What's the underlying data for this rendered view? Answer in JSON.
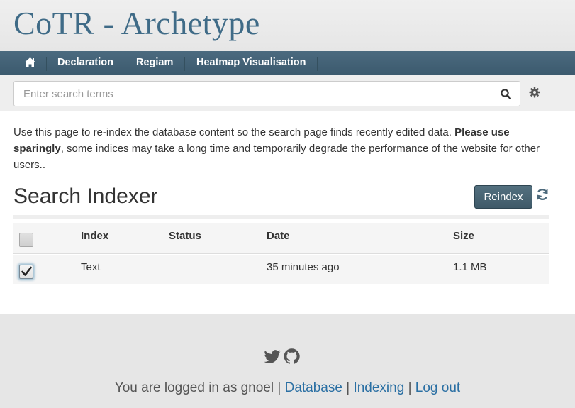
{
  "header": {
    "title": "CoTR - Archetype"
  },
  "nav": {
    "home_icon": "home-icon",
    "items": [
      {
        "label": "Declaration"
      },
      {
        "label": "Regiam"
      },
      {
        "label": "Heatmap Visualisation"
      }
    ]
  },
  "search": {
    "placeholder": "Enter search terms",
    "value": "",
    "button_icon": "search-icon",
    "settings_icon": "gear-icon"
  },
  "intro": {
    "text_before": "Use this page to re-index the database content so the search page finds recently edited data. ",
    "text_bold": "Please use sparingly",
    "text_after": ", some indices may take a long time and temporarily degrade the performance of the website for other users.."
  },
  "indexer": {
    "title": "Search Indexer",
    "reindex_label": "Reindex",
    "refresh_icon": "refresh-icon",
    "columns": [
      "Index",
      "Status",
      "Date",
      "Size"
    ],
    "rows": [
      {
        "checked": true,
        "index": "Text",
        "status": "",
        "date": "35 minutes ago",
        "size": "1.1 MB"
      }
    ],
    "header_checkbox_checked": false
  },
  "footer": {
    "icons": [
      "twitter-icon",
      "github-icon"
    ],
    "logged_in_prefix": "You are logged in as gnoel",
    "separator": " | ",
    "links": [
      {
        "label": "Database"
      },
      {
        "label": "Indexing"
      },
      {
        "label": "Log out"
      }
    ]
  },
  "colors": {
    "title": "#3f6b87",
    "navbar": "#3c5a6e",
    "link": "#2a6fa3",
    "reindex_button": "#4a6675"
  }
}
